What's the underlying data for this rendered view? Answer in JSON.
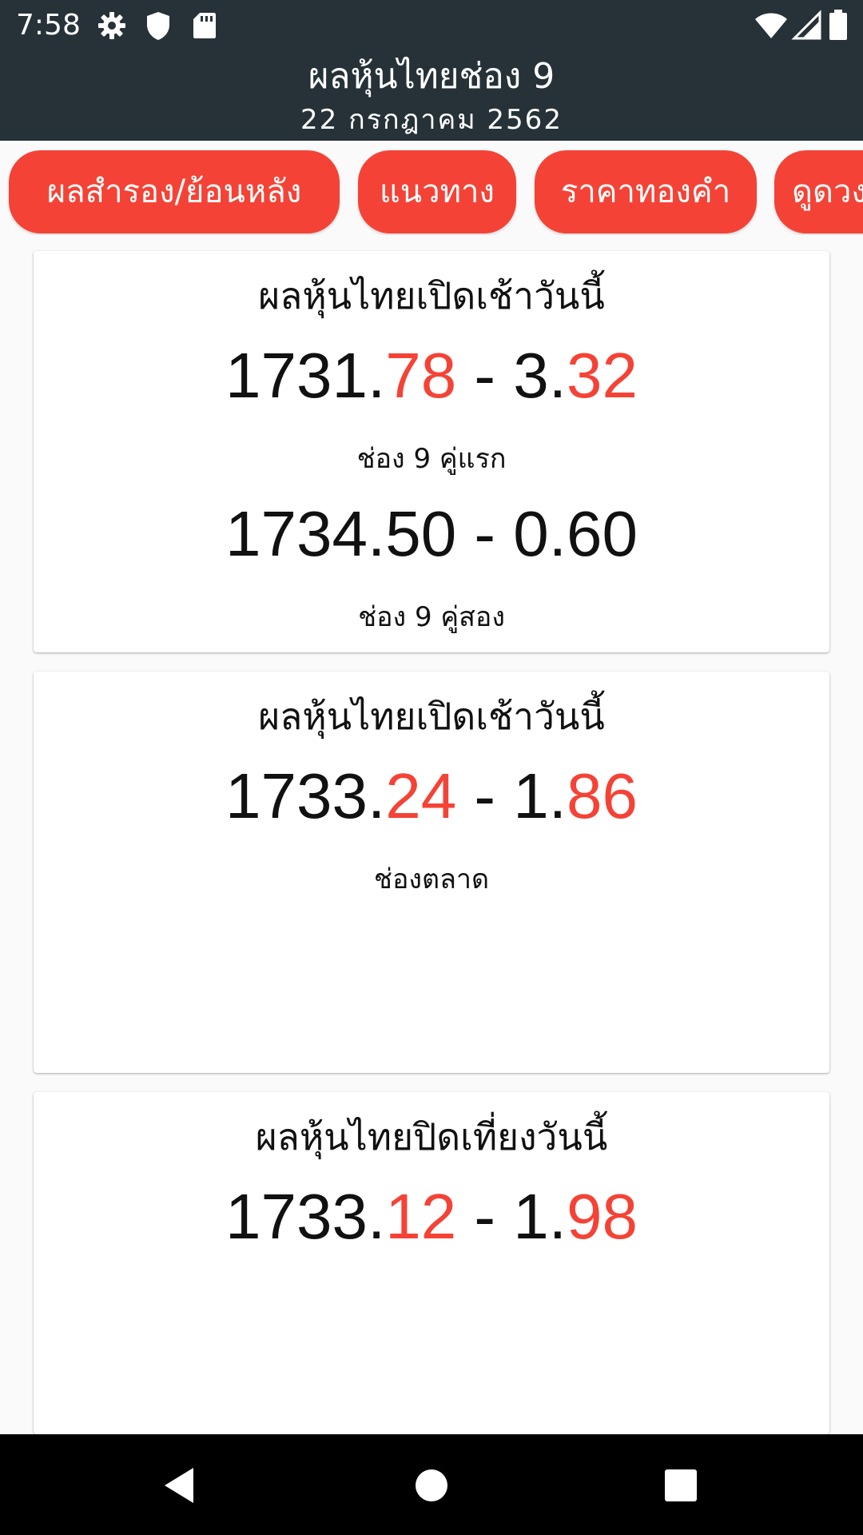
{
  "status_bar": {
    "time": "7:58",
    "left_icons": [
      "gear-icon",
      "shield-icon",
      "sd-card-icon"
    ],
    "right_icons": [
      "wifi-icon",
      "signal-icon",
      "battery-icon"
    ]
  },
  "header": {
    "title": "ผลหุ้นไทยช่อง 9",
    "date": "22  กรกฎาคม  2562"
  },
  "chips": [
    {
      "label": "ผลสำรอง/ย้อนหลัง"
    },
    {
      "label": "แนวทาง"
    },
    {
      "label": "ราคาทองคำ"
    },
    {
      "label": "ดูดวง"
    }
  ],
  "cards": [
    {
      "title": "ผลหุ้นไทยเปิดเช้าวันนี้",
      "results": [
        {
          "whole1": "1731.",
          "frac1": "78",
          "sep": " - ",
          "whole2": "3.",
          "frac2": "32",
          "label": "ช่อง 9 คู่แรก"
        },
        {
          "whole1": "1734.",
          "frac1": "50",
          "sep": " - ",
          "whole2": "0.",
          "frac2": "60",
          "label": "ช่อง 9 คู่สอง"
        }
      ]
    },
    {
      "title": "ผลหุ้นไทยเปิดเช้าวันนี้",
      "results": [
        {
          "whole1": "1733.",
          "frac1": "24",
          "sep": " - ",
          "whole2": "1.",
          "frac2": "86",
          "label": "ช่องตลาด"
        }
      ]
    },
    {
      "title": "ผลหุ้นไทยปิดเที่ยงวันนี้",
      "results": [
        {
          "whole1": "1733.",
          "frac1": "12",
          "sep": " - ",
          "whole2": "1.",
          "frac2": "98",
          "label": ""
        }
      ]
    }
  ],
  "colors": {
    "header_bg": "#263238",
    "accent": "#f44336",
    "nav_bg": "#000000"
  },
  "nav_bar": {
    "buttons": [
      "back-icon",
      "home-icon",
      "recents-icon"
    ]
  }
}
